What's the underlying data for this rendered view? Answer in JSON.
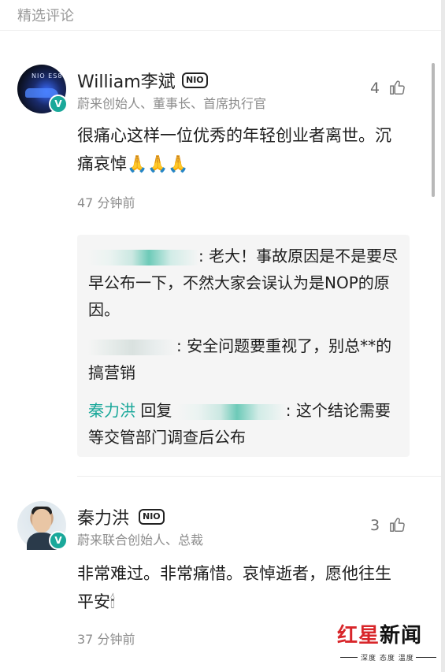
{
  "section": {
    "title": "精选评论"
  },
  "comments": [
    {
      "name": "William李斌",
      "badge": "NIO",
      "role": "蔚来创始人、董事长、首席执行官",
      "likes": "4",
      "text": "很痛心这样一位优秀的年轻创业者离世。沉痛哀悼🙏🙏🙏",
      "time": "47 分钟前",
      "verified": "V"
    },
    {
      "name": "秦力洪",
      "badge": "NIO",
      "role": "蔚来联合创始人、总裁",
      "likes": "3",
      "text": "非常难过。非常痛惜。哀悼逝者，愿他往生平安🕯",
      "time": "37 分钟前",
      "verified": "V"
    }
  ],
  "replies": [
    {
      "text": ": 老大！事故原因是不是要尽早公布一下，不然大家会误认为是NOP的原因。"
    },
    {
      "text": ": 安全问题要重视了，别总**的搞营销"
    },
    {
      "author": "秦力洪",
      "reply_word": "回复",
      "text": ": 这个结论需要等交管部门调查后公布"
    }
  ],
  "watermark": {
    "brand_red": "红星",
    "brand_black": "新闻",
    "tagline": "深度 态度 温度"
  },
  "colors": {
    "accent": "#1aa89a",
    "brand_red": "#d8262a"
  }
}
